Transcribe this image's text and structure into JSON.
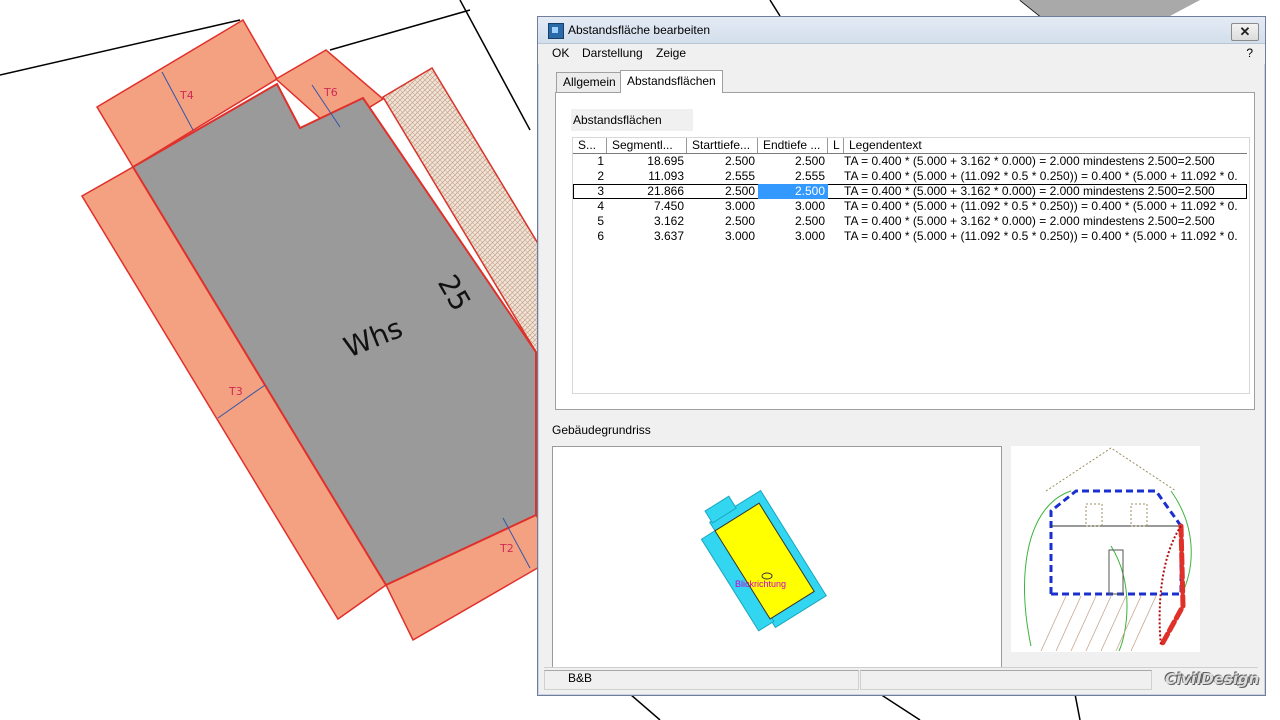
{
  "drawing": {
    "building_label": "Whs",
    "house_number": "25",
    "tags": [
      "T4",
      "T6",
      "T3",
      "T2"
    ]
  },
  "window": {
    "title": "Abstandsfläche bearbeiten",
    "close_glyph": "✕"
  },
  "menu": {
    "items": [
      "OK",
      "Darstellung",
      "Zeige"
    ],
    "help": "?"
  },
  "tabs": [
    {
      "label": "Allgemein",
      "active": false
    },
    {
      "label": "Abstandsflächen",
      "active": true
    }
  ],
  "section": {
    "label": "Abstandsflächen"
  },
  "table": {
    "columns": [
      "S...",
      "Segmentl...",
      "Starttiefe...",
      "Endtiefe ...",
      "L",
      "Legendentext"
    ],
    "rows": [
      {
        "s": "1",
        "len": "18.695",
        "start": "2.500",
        "end": "2.500",
        "l": "",
        "text": "TA = 0.400 * (5.000  + 3.162 * 0.000) = 2.000 mindestens 2.500=2.500"
      },
      {
        "s": "2",
        "len": "11.093",
        "start": "2.555",
        "end": "2.555",
        "l": "",
        "text": "TA = 0.400 * (5.000  + (11.092 * 0.5 * 0.250)) = 0.400 * (5.000  + 11.092 * 0."
      },
      {
        "s": "3",
        "len": "21.866",
        "start": "2.500",
        "end": "2.500",
        "l": "",
        "text": "TA = 0.400 * (5.000  + 3.162 * 0.000) = 2.000 mindestens 2.500=2.500"
      },
      {
        "s": "4",
        "len": "7.450",
        "start": "3.000",
        "end": "3.000",
        "l": "",
        "text": "TA = 0.400 * (5.000  + (11.092 * 0.5 * 0.250)) = 0.400 * (5.000  + 11.092 * 0."
      },
      {
        "s": "5",
        "len": "3.162",
        "start": "2.500",
        "end": "2.500",
        "l": "",
        "text": "TA = 0.400 * (5.000  + 3.162 * 0.000) = 2.000 mindestens 2.500=2.500"
      },
      {
        "s": "6",
        "len": "3.637",
        "start": "3.000",
        "end": "3.000",
        "l": "",
        "text": "TA = 0.400 * (5.000  + (11.092 * 0.5 * 0.250)) = 0.400 * (5.000  + 11.092 * 0."
      }
    ],
    "selected_row": 3
  },
  "preview": {
    "label": "Gebäudegrundriss",
    "direction_label": "Blickrichtung"
  },
  "status": {
    "text": "B&B",
    "logo": "CivilDesign"
  },
  "colors": {
    "building_fill": "#9a9a9a",
    "setback_fill": "#f4a182",
    "setback_stroke": "#e0302a",
    "selection_blue": "#3399ff",
    "preview_cyan": "#33d6f0",
    "preview_yellow": "#ffff00",
    "preview_label": "#cc00cc"
  }
}
